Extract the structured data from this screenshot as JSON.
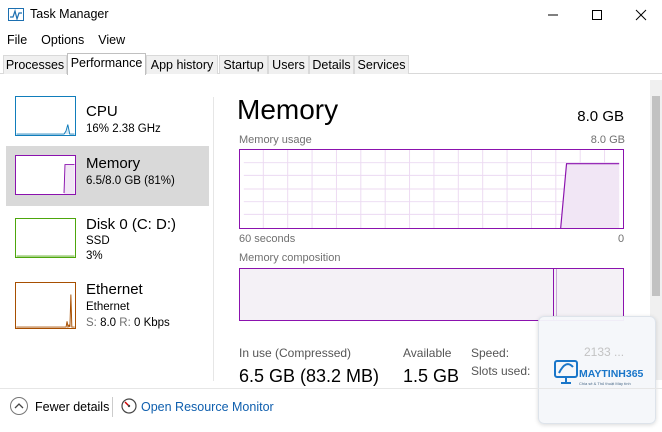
{
  "window": {
    "title": "Task Manager"
  },
  "menu": [
    "File",
    "Options",
    "View"
  ],
  "tabs": [
    "Processes",
    "Performance",
    "App history",
    "Startup",
    "Users",
    "Details",
    "Services"
  ],
  "active_tab": "Performance",
  "sidebar": {
    "cpu": {
      "title": "CPU",
      "sub": "16%  2.38 GHz"
    },
    "memory": {
      "title": "Memory",
      "sub": "6.5/8.0 GB (81%)"
    },
    "disk": {
      "title": "Disk 0 (C: D:)",
      "sub1": "SSD",
      "sub2": "3%"
    },
    "ethernet": {
      "title": "Ethernet",
      "sub1": "Ethernet",
      "s_label": "S:",
      "s_value": "8.0",
      "r_label": "R:",
      "r_value": "0 Kbps"
    }
  },
  "main": {
    "title": "Memory",
    "total": "8.0 GB",
    "usage_label": "Memory usage",
    "usage_max": "8.0 GB",
    "time_left": "60 seconds",
    "time_right": "0",
    "composition_label": "Memory composition",
    "in_use_label": "In use (Compressed)",
    "in_use_value": "6.5 GB (83.2 MB)",
    "available_label": "Available",
    "available_value": "1.5 GB",
    "speed_label": "Speed:",
    "speed_value": "2133 ...",
    "slots_label": "Slots used:"
  },
  "footer": {
    "fewer_details": "Fewer details",
    "open_resource_monitor": "Open Resource Monitor"
  },
  "watermark": {
    "brand": "MAYTINH365",
    "tagline": "Chia sẻ & Thủ thuật Máy tính"
  },
  "colors": {
    "memory": "#8b12ae",
    "cpu": "#117dbb",
    "disk": "#4da60c",
    "ethernet": "#a74f01",
    "link": "#0f5fae"
  }
}
